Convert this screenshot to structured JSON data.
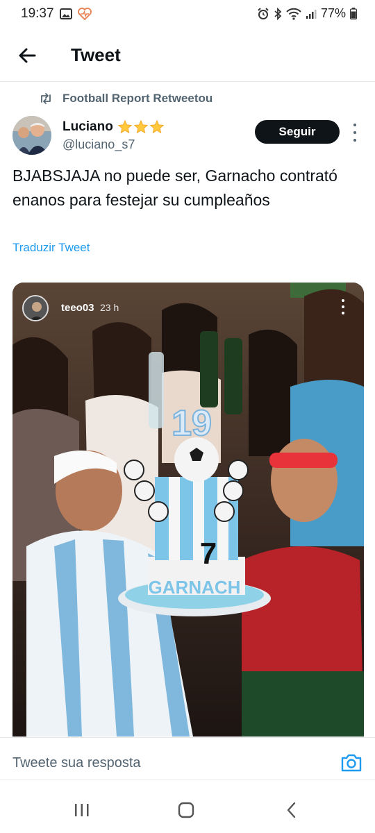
{
  "status_bar": {
    "time": "19:37",
    "battery": "77%",
    "icons": [
      "image-icon",
      "health-icon",
      "alarm-icon",
      "bluetooth-icon",
      "wifi-icon",
      "signal-icon",
      "battery-icon"
    ]
  },
  "header": {
    "title": "Tweet",
    "back_icon": "arrow-left-icon"
  },
  "retweet": {
    "text": "Football Report Retweetou",
    "icon": "retweet-icon"
  },
  "author": {
    "name": "Luciano",
    "handle": "@luciano_s7",
    "emoji": "three-stars"
  },
  "follow_button": "Seguir",
  "tweet": {
    "text": "BJABSJAJA no puede ser, Garnacho contrató enanos para festejar su cumpleaños",
    "translate": "Traduzir Tweet"
  },
  "media": {
    "story_username": "teeo03",
    "story_time": "23 h",
    "cake_text": "GARNACH",
    "cake_number": "7",
    "candle_text": "19"
  },
  "reply": {
    "placeholder": "Tweete sua resposta",
    "camera_icon": "camera-icon"
  },
  "nav": {
    "icons": [
      "recents-icon",
      "home-icon",
      "back-icon"
    ]
  },
  "colors": {
    "link": "#1d9bf0",
    "secondary_text": "#536471",
    "primary_text": "#0f1419",
    "follow_bg": "#0f1419",
    "star": "#ffc83d"
  }
}
